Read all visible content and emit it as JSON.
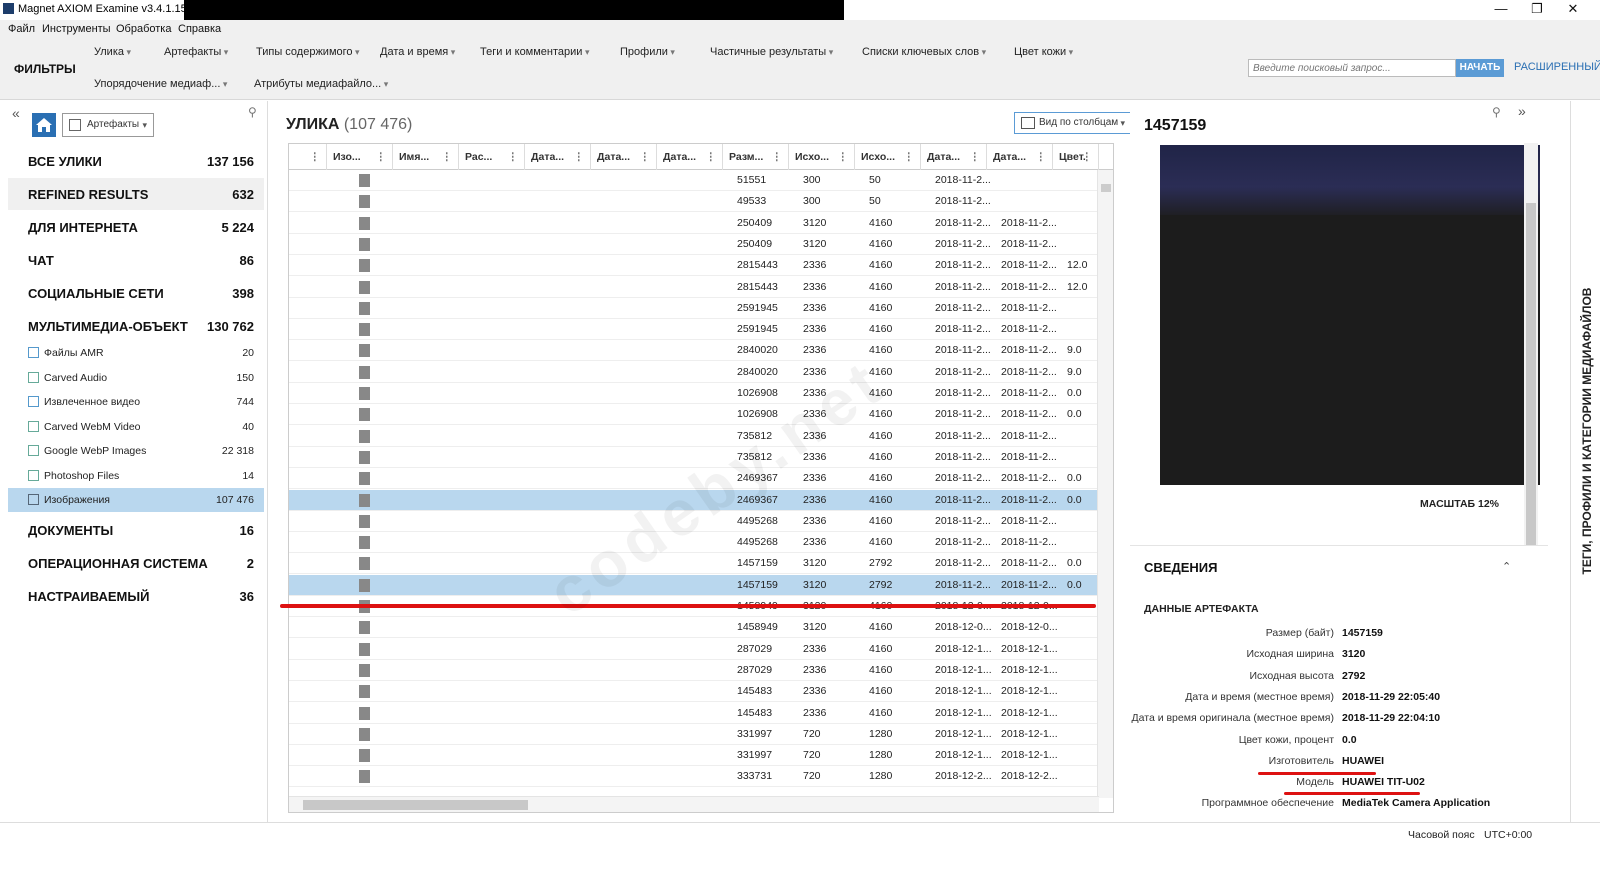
{
  "window": {
    "title": "Magnet AXIOM Examine v3.4.1.15164",
    "minimize": "—",
    "maximize": "❐",
    "close": "✕"
  },
  "menu": [
    "Файл",
    "Инструменты",
    "Обработка",
    "Справка"
  ],
  "filters": {
    "label": "ФИЛЬТРЫ",
    "row1": [
      "Улика",
      "Артефакты",
      "Типы содержимого",
      "Дата и время",
      "Теги и комментарии",
      "Профили",
      "Частичные результаты",
      "Списки ключевых слов",
      "Цвет кожи"
    ],
    "row2": [
      "Упорядочение медиаф...",
      "Атрибуты медиафайло..."
    ],
    "search_placeholder": "Введите поисковый запрос...",
    "start_label": "НАЧАТЬ",
    "advanced_label": "РАСШИРЕННЫЙ"
  },
  "left": {
    "selector_label": "Артефакты",
    "categories": [
      {
        "label": "ВСЕ УЛИКИ",
        "count": "137 156"
      },
      {
        "label": "REFINED RESULTS",
        "count": "632"
      },
      {
        "label": "ДЛЯ ИНТЕРНЕТА",
        "count": "5 224"
      },
      {
        "label": "ЧАТ",
        "count": "86"
      },
      {
        "label": "СОЦИАЛЬНЫЕ СЕТИ",
        "count": "398"
      },
      {
        "label": "МУЛЬТИМЕДИА-ОБЪЕКТ",
        "count": "130 762"
      }
    ],
    "subitems": [
      {
        "label": "Файлы AMR",
        "count": "20"
      },
      {
        "label": "Carved Audio",
        "count": "150"
      },
      {
        "label": "Извлеченное видео",
        "count": "744"
      },
      {
        "label": "Carved WebM Video",
        "count": "40"
      },
      {
        "label": "Google WebP Images",
        "count": "22 318"
      },
      {
        "label": "Photoshop Files",
        "count": "14"
      },
      {
        "label": "Изображения",
        "count": "107 476"
      }
    ],
    "categories_bottom": [
      {
        "label": "ДОКУМЕНТЫ",
        "count": "16"
      },
      {
        "label": "ОПЕРАЦИОННАЯ СИСТЕМА",
        "count": "2"
      },
      {
        "label": "НАСТРАИВАЕМЫЙ",
        "count": "36"
      }
    ]
  },
  "center": {
    "title": "УЛИКА",
    "count": "(107 476)",
    "view_label": "Вид по столбцам",
    "columns": [
      "Изо...",
      "Имя...",
      "Рас...",
      "Дата...",
      "Дата...",
      "Дата...",
      "Разм...",
      "Исхо...",
      "Исхо...",
      "Дата...",
      "Дата...",
      "Цвет."
    ],
    "rows": [
      [
        "51551",
        "300",
        "50",
        "2018-11-2...",
        "",
        ""
      ],
      [
        "49533",
        "300",
        "50",
        "2018-11-2...",
        "",
        ""
      ],
      [
        "250409",
        "3120",
        "4160",
        "2018-11-2...",
        "2018-11-2...",
        ""
      ],
      [
        "250409",
        "3120",
        "4160",
        "2018-11-2...",
        "2018-11-2...",
        ""
      ],
      [
        "2815443",
        "2336",
        "4160",
        "2018-11-2...",
        "2018-11-2...",
        "12.0"
      ],
      [
        "2815443",
        "2336",
        "4160",
        "2018-11-2...",
        "2018-11-2...",
        "12.0"
      ],
      [
        "2591945",
        "2336",
        "4160",
        "2018-11-2...",
        "2018-11-2...",
        ""
      ],
      [
        "2591945",
        "2336",
        "4160",
        "2018-11-2...",
        "2018-11-2...",
        ""
      ],
      [
        "2840020",
        "2336",
        "4160",
        "2018-11-2...",
        "2018-11-2...",
        "9.0"
      ],
      [
        "2840020",
        "2336",
        "4160",
        "2018-11-2...",
        "2018-11-2...",
        "9.0"
      ],
      [
        "1026908",
        "2336",
        "4160",
        "2018-11-2...",
        "2018-11-2...",
        "0.0"
      ],
      [
        "1026908",
        "2336",
        "4160",
        "2018-11-2...",
        "2018-11-2...",
        "0.0"
      ],
      [
        "735812",
        "2336",
        "4160",
        "2018-11-2...",
        "2018-11-2...",
        ""
      ],
      [
        "735812",
        "2336",
        "4160",
        "2018-11-2...",
        "2018-11-2...",
        ""
      ],
      [
        "2469367",
        "2336",
        "4160",
        "2018-11-2...",
        "2018-11-2...",
        "0.0"
      ],
      [
        "2469367",
        "2336",
        "4160",
        "2018-11-2...",
        "2018-11-2...",
        "0.0"
      ],
      [
        "4495268",
        "2336",
        "4160",
        "2018-11-2...",
        "2018-11-2...",
        ""
      ],
      [
        "4495268",
        "2336",
        "4160",
        "2018-11-2...",
        "2018-11-2...",
        ""
      ],
      [
        "1457159",
        "3120",
        "2792",
        "2018-11-2...",
        "2018-11-2...",
        "0.0"
      ],
      [
        "1457159",
        "3120",
        "2792",
        "2018-11-2...",
        "2018-11-2...",
        "0.0"
      ],
      [
        "1458949",
        "3120",
        "4160",
        "2018-12-0...",
        "2018-12-0...",
        ""
      ],
      [
        "1458949",
        "3120",
        "4160",
        "2018-12-0...",
        "2018-12-0...",
        ""
      ],
      [
        "287029",
        "2336",
        "4160",
        "2018-12-1...",
        "2018-12-1...",
        ""
      ],
      [
        "287029",
        "2336",
        "4160",
        "2018-12-1...",
        "2018-12-1...",
        ""
      ],
      [
        "145483",
        "2336",
        "4160",
        "2018-12-1...",
        "2018-12-1...",
        ""
      ],
      [
        "145483",
        "2336",
        "4160",
        "2018-12-1...",
        "2018-12-1...",
        ""
      ],
      [
        "331997",
        "720",
        "1280",
        "2018-12-1...",
        "2018-12-1...",
        ""
      ],
      [
        "331997",
        "720",
        "1280",
        "2018-12-1...",
        "2018-12-1...",
        ""
      ],
      [
        "333731",
        "720",
        "1280",
        "2018-12-2...",
        "2018-12-2...",
        ""
      ]
    ],
    "selected_rows": [
      15,
      19
    ]
  },
  "right": {
    "title": "1457159",
    "zoom_label": "МАСШТАБ 12%",
    "details_title": "СВЕДЕНИЯ",
    "section_title": "ДАННЫЕ АРТЕФАКТА",
    "props": [
      {
        "k": "Размер (байт)",
        "v": "1457159"
      },
      {
        "k": "Исходная ширина",
        "v": "3120"
      },
      {
        "k": "Исходная высота",
        "v": "2792"
      },
      {
        "k": "Дата и время (местное время)",
        "v": "2018-11-29 22:05:40"
      },
      {
        "k": "Дата и время оригинала (местное время)",
        "v": "2018-11-29 22:04:10"
      },
      {
        "k": "Цвет кожи, процент",
        "v": "0.0"
      },
      {
        "k": "Изготовитель",
        "v": "HUAWEI"
      },
      {
        "k": "Модель",
        "v": "HUAWEI TIT-U02"
      },
      {
        "k": "Программное обеспечение",
        "v": "MediaTek Camera Application"
      }
    ]
  },
  "vtab_label": "ТЕГИ, ПРОФИЛИ И КАТЕГОРИИ МЕДИАФАЙЛОВ",
  "status": {
    "tz_label": "Часовой пояс",
    "tz_value": "UTC+0:00"
  },
  "watermark": "codeby.net",
  "accent": "#5b9bd5",
  "selection_color": "#b9d7ee",
  "annotation_color": "#d11"
}
